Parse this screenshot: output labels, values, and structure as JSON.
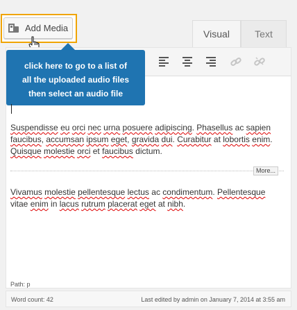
{
  "toolbar": {
    "add_media_label": "Add Media",
    "tabs": {
      "visual": "Visual",
      "text": "Text"
    }
  },
  "icons": {
    "add_media": "add-media-icon",
    "cursor": "hand-pointer-icon",
    "format": [
      "align-left-icon",
      "align-center-icon",
      "align-right-icon",
      "link-icon",
      "unlink-icon"
    ]
  },
  "tooltip": {
    "lines": [
      "click here to go to a list of",
      "all the uploaded audio files",
      "then select an audio file"
    ]
  },
  "content": {
    "p1": [
      {
        "t": "Suspendisse",
        "s": true
      },
      {
        "t": " "
      },
      {
        "t": "eu",
        "s": true
      },
      {
        "t": " "
      },
      {
        "t": "orci",
        "s": true
      },
      {
        "t": " "
      },
      {
        "t": "nec",
        "s": true
      },
      {
        "t": " "
      },
      {
        "t": "urna",
        "s": true
      },
      {
        "t": " "
      },
      {
        "t": "posuere",
        "s": true
      },
      {
        "t": " "
      },
      {
        "t": "adipiscing",
        "s": true
      },
      {
        "t": ". "
      },
      {
        "t": "Phasellus",
        "s": true
      },
      {
        "t": " ac "
      },
      {
        "t": "sapien",
        "s": true
      },
      {
        "t": " "
      },
      {
        "t": "faucibus",
        "s": true
      },
      {
        "t": ", "
      },
      {
        "t": "accumsan",
        "s": true
      },
      {
        "t": " "
      },
      {
        "t": "ipsum",
        "s": true
      },
      {
        "t": " "
      },
      {
        "t": "eget",
        "s": true
      },
      {
        "t": ", "
      },
      {
        "t": "gravida",
        "s": true
      },
      {
        "t": " "
      },
      {
        "t": "dui",
        "s": true
      },
      {
        "t": ". "
      },
      {
        "t": "Curabitur",
        "s": true
      },
      {
        "t": " at "
      },
      {
        "t": "lobortis",
        "s": true
      },
      {
        "t": " "
      },
      {
        "t": "enim",
        "s": true
      },
      {
        "t": ". "
      },
      {
        "t": "Quisque",
        "s": true
      },
      {
        "t": " "
      },
      {
        "t": "molestie",
        "s": true
      },
      {
        "t": " "
      },
      {
        "t": "orci",
        "s": true
      },
      {
        "t": " et "
      },
      {
        "t": "faucibus",
        "s": true
      },
      {
        "t": " dictum."
      }
    ],
    "more_label": "More...",
    "p2": [
      {
        "t": "Vivamus",
        "s": true
      },
      {
        "t": " "
      },
      {
        "t": "molestie",
        "s": true
      },
      {
        "t": " "
      },
      {
        "t": "pellentesque",
        "s": true
      },
      {
        "t": " "
      },
      {
        "t": "lectus",
        "s": true
      },
      {
        "t": " ac "
      },
      {
        "t": "condimentum",
        "s": true
      },
      {
        "t": ". "
      },
      {
        "t": "Pellentesque",
        "s": true
      },
      {
        "t": " vitae "
      },
      {
        "t": "enim",
        "s": true
      },
      {
        "t": " in "
      },
      {
        "t": "lacus",
        "s": true
      },
      {
        "t": " "
      },
      {
        "t": "rutrum",
        "s": true
      },
      {
        "t": " "
      },
      {
        "t": "placerat",
        "s": true
      },
      {
        "t": " "
      },
      {
        "t": "eget",
        "s": true
      },
      {
        "t": " at "
      },
      {
        "t": "nibh",
        "s": true
      },
      {
        "t": "."
      }
    ]
  },
  "status": {
    "path": "Path: p",
    "word_count": "Word count: 42",
    "last_edited": "Last edited by admin on January 7, 2014 at 3:55 am"
  },
  "colors": {
    "highlight": "#f0a400",
    "tooltip_bg": "#1f74b1",
    "spell_underline": "#dd0000"
  }
}
